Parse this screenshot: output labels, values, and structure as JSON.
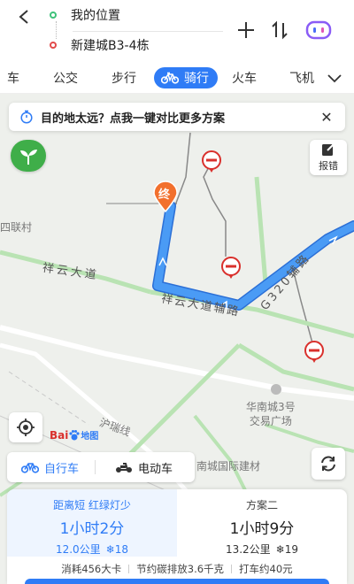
{
  "header": {
    "back_icon": "back-arrow-icon",
    "origin": "我的位置",
    "destination": "新建城B3-4栋",
    "origin_color": "#3ec27a",
    "destination_color": "#e24b4b",
    "add_icon": "plus-icon",
    "swap_icon": "swap-icon",
    "assistant_icon": "assistant-icon"
  },
  "tabs": [
    {
      "label": "车"
    },
    {
      "label": "公交"
    },
    {
      "label": "步行"
    },
    {
      "label": "骑行",
      "active": true
    },
    {
      "label": "火车"
    },
    {
      "label": "飞机"
    }
  ],
  "banner": {
    "text": "目的地太远？点我一键对比更多方案",
    "icon": "stopwatch-icon",
    "close": "✕"
  },
  "map": {
    "labels": {
      "village": "四联村",
      "road1": "祥云大道",
      "road2": "祥云大道辅路",
      "road3": "G320辅路",
      "poi": "华南城3号交易广场",
      "poi_line1": "华南城3号",
      "poi_line2": "交易广场",
      "poi2": "南城国际建材",
      "rail": "沪瑞线"
    },
    "end_marker": "终",
    "route_color": "#3a8cf0"
  },
  "controls": {
    "report_label": "报错",
    "baidu_logo": "Bai",
    "baidu_logo_suffix": "地图"
  },
  "modes": {
    "bike": "自行车",
    "ebike": "电动车"
  },
  "plans": [
    {
      "tag": "距离短 红绿灯少",
      "time": "1小时2分",
      "distance": "12.0公里",
      "lights": "18"
    },
    {
      "tag": "方案二",
      "time": "1小时9分",
      "distance": "13.2公里",
      "lights": "19"
    }
  ],
  "info": {
    "calories": "消耗456大卡",
    "carbon": "节约碳排放3.6千克",
    "taxi": "打车约40元"
  },
  "colors": {
    "accent": "#2f7cf6",
    "leaf": "#3fae49",
    "no_entry": "#d9302c"
  }
}
